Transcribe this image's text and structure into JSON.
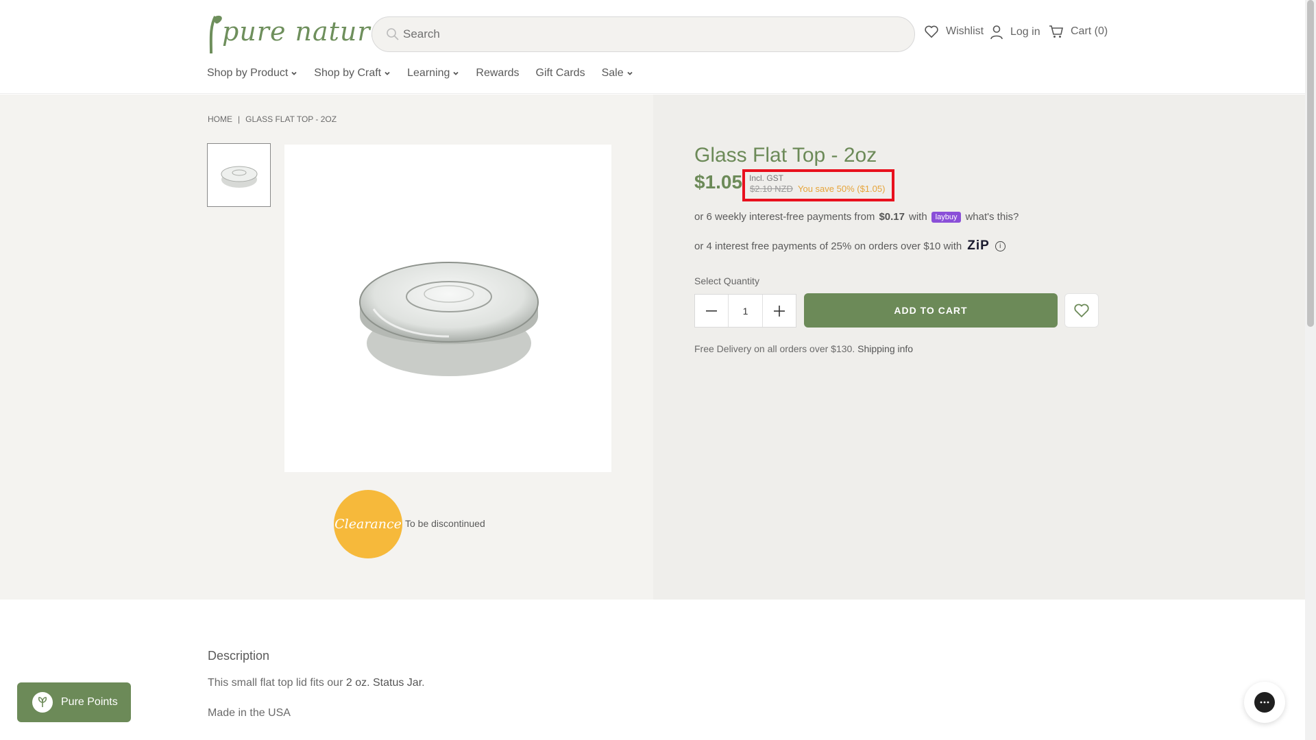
{
  "brand": {
    "name": "pure nature",
    "color": "#6c8a58"
  },
  "search": {
    "placeholder": "Search"
  },
  "header_links": {
    "wishlist": "Wishlist",
    "login": "Log in",
    "cart": "Cart (0)"
  },
  "nav": [
    {
      "label": "Shop by Product",
      "dropdown": true
    },
    {
      "label": "Shop by Craft",
      "dropdown": true
    },
    {
      "label": "Learning",
      "dropdown": true
    },
    {
      "label": "Rewards",
      "dropdown": false
    },
    {
      "label": "Gift Cards",
      "dropdown": false
    },
    {
      "label": "Sale",
      "dropdown": true
    }
  ],
  "breadcrumb": {
    "home": "HOME",
    "separator": "|",
    "current": "GLASS FLAT TOP - 2OZ"
  },
  "product": {
    "title": "Glass Flat Top - 2oz",
    "price": "$1.05",
    "gst_note": "Incl. GST",
    "was_price": "$2.10 NZD",
    "savings": "You save 50% ($1.05)",
    "badge": "Clearance",
    "badge_note": "To be discontinued",
    "badge_color": "#f6b93b"
  },
  "payments": {
    "laybuy_prefix": "or 6 weekly interest-free payments from",
    "laybuy_amount": "$0.17",
    "laybuy_with": "with",
    "laybuy_logo": "laybuy",
    "laybuy_help": "what's this?",
    "zip_text": "or 4 interest free payments of 25% on orders over $10 with",
    "zip_logo": "ZiP"
  },
  "quantity": {
    "label": "Select Quantity",
    "value": "1",
    "minus": "−",
    "plus": "+"
  },
  "actions": {
    "add_to_cart": "ADD TO CART"
  },
  "delivery": {
    "text": "Free Delivery on all orders over $130.",
    "link": "Shipping info"
  },
  "description": {
    "title": "Description",
    "p1_prefix": "This small flat top lid fits our",
    "p1_link": "2 oz. Status Jar",
    "p1_suffix": ".",
    "p2": "Made in the USA"
  },
  "rewards_widget": {
    "label": "Pure Points"
  },
  "highlight_color": "#e8101d"
}
